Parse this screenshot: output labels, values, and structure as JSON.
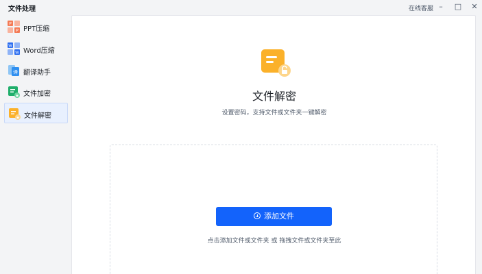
{
  "app": {
    "title": "文件处理"
  },
  "titlebar": {
    "service": "在线客服",
    "minimize": "–",
    "maximize": "□",
    "close": "✕"
  },
  "sidebar": {
    "items": [
      {
        "label": "PPT压缩",
        "icon": "ppt-compress-icon",
        "active": false
      },
      {
        "label": "Word压缩",
        "icon": "word-compress-icon",
        "active": false
      },
      {
        "label": "翻译助手",
        "icon": "translate-icon",
        "active": false
      },
      {
        "label": "文件加密",
        "icon": "file-encrypt-icon",
        "active": false
      },
      {
        "label": "文件解密",
        "icon": "file-decrypt-icon",
        "active": true
      }
    ]
  },
  "main": {
    "title": "文件解密",
    "subtitle": "设置密码，支持文件或文件夹一键解密",
    "add_button": "添加文件",
    "drop_hint": "点击添加文件或文件夹 或 拖拽文件或文件夹至此"
  },
  "colors": {
    "accent": "#1363fb",
    "decrypt_icon": "#fbb12a",
    "encrypt_icon": "#1fae6b",
    "ppt_icon": "#f47a55",
    "word_icon": "#2d6ef0"
  }
}
